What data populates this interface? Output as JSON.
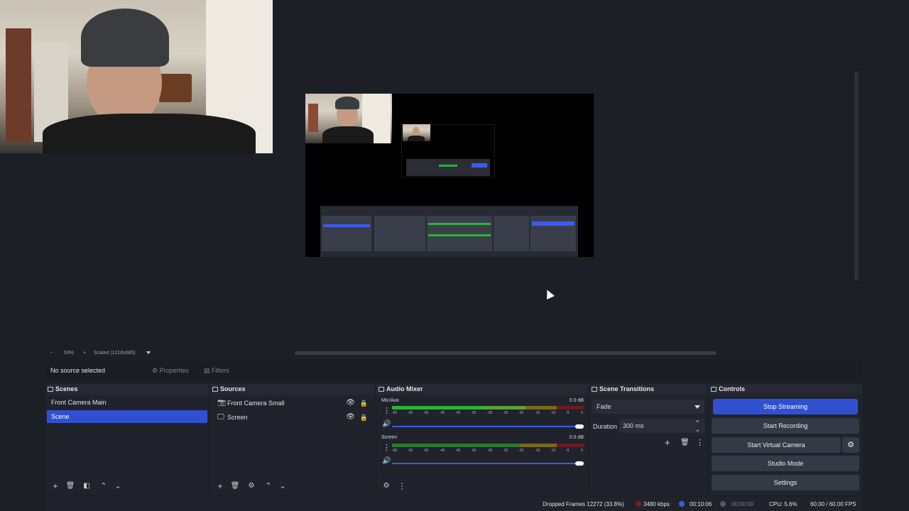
{
  "preview": {
    "zoom_minus": "−",
    "zoom_level": "63%",
    "zoom_plus": "+",
    "scaled_label": "Scaled (1218x685)"
  },
  "properties_bar": {
    "no_source": "No source selected",
    "properties_label": "Properties",
    "filters_label": "Filters"
  },
  "scenes": {
    "title": "Scenes",
    "items": [
      {
        "label": "Front Camera Main",
        "selected": false
      },
      {
        "label": "Scene",
        "selected": true
      }
    ]
  },
  "sources": {
    "title": "Sources",
    "items": [
      {
        "label": "Front Camera Small",
        "icon": "camera-icon"
      },
      {
        "label": "Screen",
        "icon": "monitor-icon"
      }
    ]
  },
  "audio_mixer": {
    "title": "Audio Mixer",
    "tracks": [
      {
        "name": "Mic/Aux",
        "db": "0.0 dB"
      },
      {
        "name": "Screen",
        "db": "0.0 dB"
      }
    ],
    "scale": [
      "-60",
      "-55",
      "-50",
      "-45",
      "-40",
      "-35",
      "-30",
      "-25",
      "-20",
      "-15",
      "-10",
      "-5",
      "0"
    ]
  },
  "transitions": {
    "title": "Scene Transitions",
    "selected": "Fade",
    "duration_label": "Duration",
    "duration_value": "300 ms"
  },
  "controls": {
    "title": "Controls",
    "stop_streaming": "Stop Streaming",
    "start_recording": "Start Recording",
    "start_virtual_camera": "Start Virtual Camera",
    "studio_mode": "Studio Mode",
    "settings": "Settings"
  },
  "status": {
    "dropped_frames": "Dropped Frames 12272 (33.8%)",
    "bitrate": "3480 kbps",
    "stream_time": "00:10:06",
    "record_time": "00:00:00",
    "cpu": "CPU: 5.6%",
    "fps": "60.00 / 60.00 FPS"
  },
  "colors": {
    "accent": "#2f51d1",
    "meter_green": "#2bb33a",
    "meter_yellow": "#c7a21a",
    "meter_red": "#c0262c"
  }
}
